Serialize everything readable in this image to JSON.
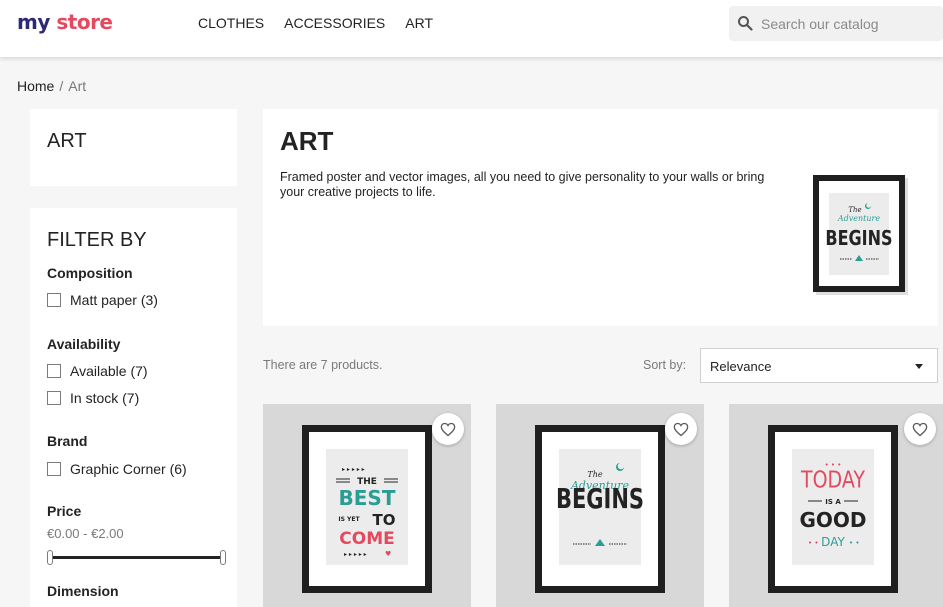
{
  "header": {
    "logo_part1": "my",
    "logo_part2": "store",
    "nav": [
      "CLOTHES",
      "ACCESSORIES",
      "ART"
    ],
    "search_placeholder": "Search our catalog"
  },
  "breadcrumb": {
    "home": "Home",
    "separator": "/",
    "current": "Art"
  },
  "sidebar": {
    "category_title": "ART",
    "filter_title": "FILTER BY",
    "facets": [
      {
        "title": "Composition",
        "options": [
          "Matt paper (3)"
        ]
      },
      {
        "title": "Availability",
        "options": [
          "Available (7)",
          "In stock (7)"
        ]
      },
      {
        "title": "Brand",
        "options": [
          "Graphic Corner (6)"
        ]
      },
      {
        "title": "Price",
        "range": "€0.00 - €2.00",
        "slider_min": 0,
        "slider_max": 1
      },
      {
        "title": "Dimension"
      }
    ]
  },
  "category": {
    "title": "ART",
    "description": "Framed poster and vector images, all you need to give personality to your walls or bring your creative projects to life.",
    "image_text": [
      "The",
      "Adventure",
      "BEGINS"
    ]
  },
  "listing": {
    "count_text": "There are 7 products.",
    "sort_label": "Sort by:",
    "sort_value": "Relevance"
  },
  "products": [
    {
      "poster_text": [
        "THE",
        "BEST",
        "IS YET",
        "TO",
        "COME"
      ]
    },
    {
      "poster_text": [
        "The",
        "Adventure",
        "BEGINS"
      ]
    },
    {
      "poster_text": [
        "TODAY",
        "IS A",
        "GOOD",
        "DAY"
      ]
    }
  ],
  "colors": {
    "logo_my": "#2d2a75",
    "logo_store": "#e34a5f",
    "teal": "#2a9d95",
    "red": "#e34a5f",
    "dark": "#232323"
  }
}
